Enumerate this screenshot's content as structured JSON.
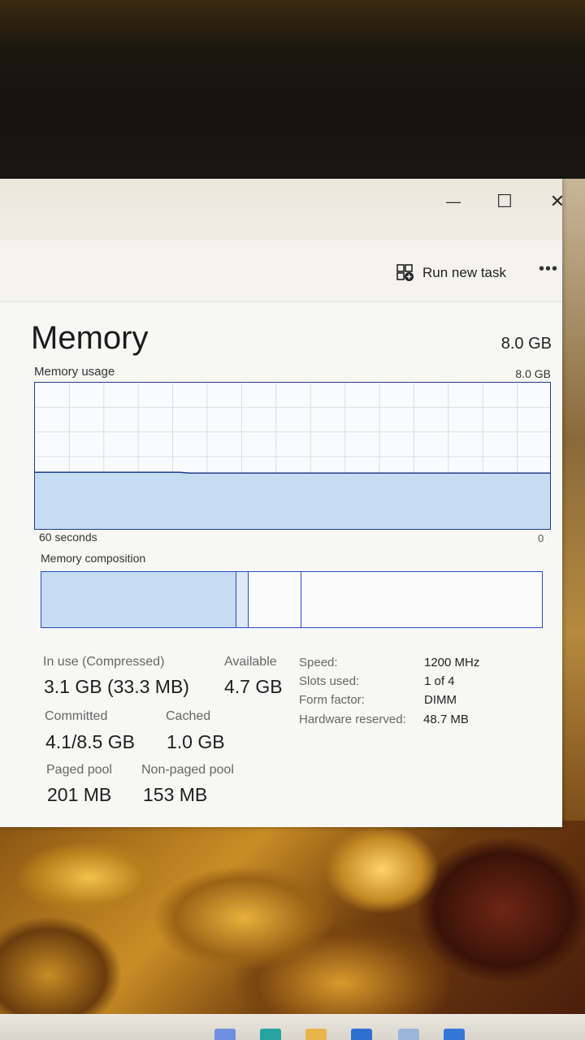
{
  "window": {
    "controls": {
      "minimize": "—",
      "maximize": "☐",
      "close": "✕"
    }
  },
  "toolbar": {
    "run_new_task": "Run new task",
    "more": "•••",
    "run_icon": "run-task-icon"
  },
  "memory": {
    "title": "Memory",
    "total": "8.0 GB",
    "usage_label": "Memory usage",
    "usage_max": "8.0 GB",
    "graph_time": "60 seconds",
    "graph_min": "0",
    "usage_fraction": 0.4,
    "composition_label": "Memory composition"
  },
  "stats": {
    "in_use_label": "In use (Compressed)",
    "in_use_value": "3.1 GB (33.3 MB)",
    "available_label": "Available",
    "available_value": "4.7 GB",
    "committed_label": "Committed",
    "committed_value": "4.1/8.5 GB",
    "cached_label": "Cached",
    "cached_value": "1.0 GB",
    "paged_pool_label": "Paged pool",
    "paged_pool_value": "201 MB",
    "non_paged_pool_label": "Non-paged pool",
    "non_paged_pool_value": "153 MB"
  },
  "specs": {
    "speed_label": "Speed:",
    "speed_value": "1200 MHz",
    "slots_label": "Slots used:",
    "slots_value": "1 of 4",
    "form_label": "Form factor:",
    "form_value": "DIMM",
    "reserved_label": "Hardware reserved:",
    "reserved_value": "48.7 MB"
  },
  "colors": {
    "graph_line": "#1f3c88",
    "graph_fill": "#c6dcf3",
    "composition_border": "#2a4bc0"
  }
}
